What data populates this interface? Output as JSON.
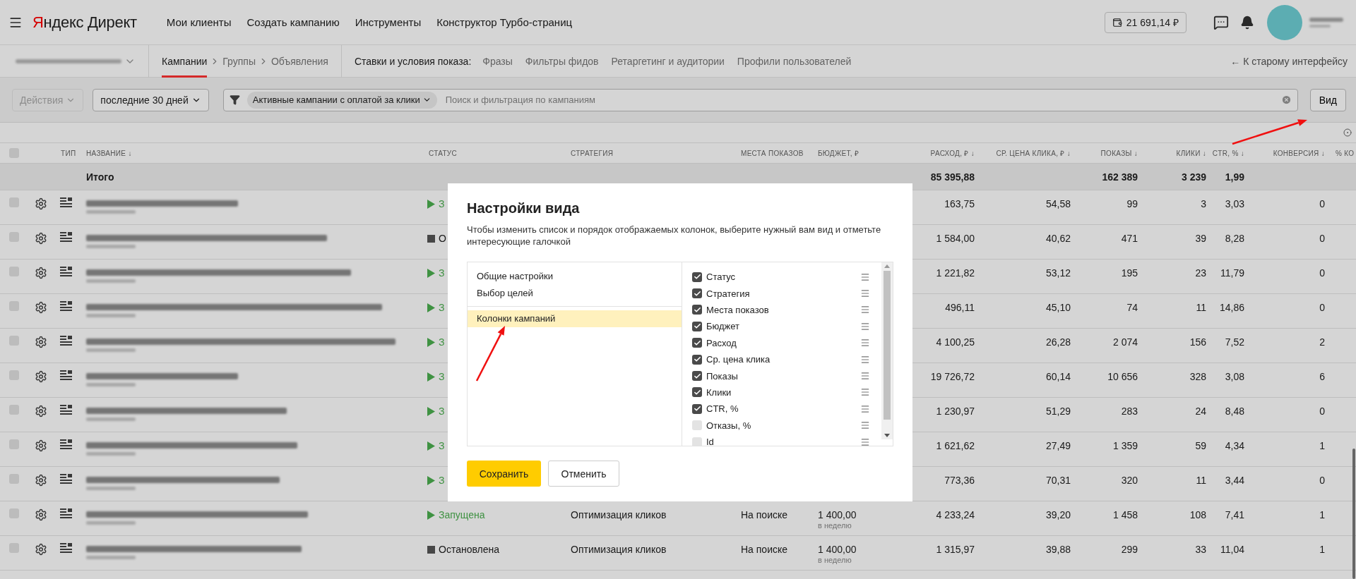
{
  "header": {
    "logo": {
      "brand": "Яндекс",
      "product": "Директ"
    },
    "nav": [
      "Мои клиенты",
      "Создать кампанию",
      "Инструменты",
      "Конструктор Турбо-страниц"
    ],
    "balance": "21 691,14 ₽"
  },
  "subnav": {
    "levels": [
      {
        "label": "Кампании",
        "selected": true
      },
      {
        "label": "Группы",
        "selected": false
      },
      {
        "label": "Объявления",
        "selected": false
      }
    ],
    "conditions_label": "Ставки и условия показа:",
    "conditions": [
      "Фразы",
      "Фильтры фидов",
      "Ретаргетинг и аудитории",
      "Профили пользователей"
    ],
    "old_interface": "← К старому интерфейсу"
  },
  "toolbar": {
    "actions": {
      "label": "Действия",
      "disabled": true
    },
    "period": "последние 30 дней",
    "filter_chip": "Активные кампании с оплатой за клики",
    "search": {
      "placeholder": "Поиск и фильтрация по кампаниям"
    },
    "view_button": "Вид"
  },
  "table": {
    "header_checkbox": {
      "checked": false
    },
    "columns": [
      "ТИП",
      "НАЗВАНИЕ ↓",
      "СТАТУС",
      "СТРАТЕГИЯ",
      "МЕСТА ПОКАЗОВ",
      "БЮДЖЕТ, ₽",
      "РАСХОД, ₽ ↓",
      "СР. ЦЕНА КЛИКА, ₽ ↓",
      "ПОКАЗЫ ↓",
      "КЛИКИ ↓",
      "CTR, % ↓",
      "КОНВЕРСИЯ ↓",
      "% КО"
    ],
    "total": {
      "label": "Итого",
      "spend": "85 395,88",
      "impressions": "162 389",
      "clicks": "3 239",
      "ctr": "1,99"
    },
    "rows": [
      {
        "checked": false,
        "status": {
          "kind": "running",
          "text": "З"
        },
        "spend": "163,75",
        "cpc": "54,58",
        "impressions": "99",
        "clicks": "3",
        "ctr": "3,03",
        "conversions": "0"
      },
      {
        "checked": false,
        "status": {
          "kind": "stopped",
          "text": "О"
        },
        "spend": "1 584,00",
        "cpc": "40,62",
        "impressions": "471",
        "clicks": "39",
        "ctr": "8,28",
        "conversions": "0"
      },
      {
        "checked": false,
        "status": {
          "kind": "running",
          "text": "З"
        },
        "spend": "1 221,82",
        "cpc": "53,12",
        "impressions": "195",
        "clicks": "23",
        "ctr": "11,79",
        "conversions": "0"
      },
      {
        "checked": false,
        "status": {
          "kind": "running",
          "text": "З"
        },
        "spend": "496,11",
        "cpc": "45,10",
        "impressions": "74",
        "clicks": "11",
        "ctr": "14,86",
        "conversions": "0"
      },
      {
        "checked": false,
        "status": {
          "kind": "running",
          "text": "З"
        },
        "spend": "4 100,25",
        "cpc": "26,28",
        "impressions": "2 074",
        "clicks": "156",
        "ctr": "7,52",
        "conversions": "2"
      },
      {
        "checked": false,
        "status": {
          "kind": "running",
          "text": "З"
        },
        "spend": "19 726,72",
        "cpc": "60,14",
        "impressions": "10 656",
        "clicks": "328",
        "ctr": "3,08",
        "conversions": "6"
      },
      {
        "checked": false,
        "status": {
          "kind": "running",
          "text": "З"
        },
        "spend": "1 230,97",
        "cpc": "51,29",
        "impressions": "283",
        "clicks": "24",
        "ctr": "8,48",
        "conversions": "0"
      },
      {
        "checked": false,
        "status": {
          "kind": "running",
          "text": "З"
        },
        "spend": "1 621,62",
        "cpc": "27,49",
        "impressions": "1 359",
        "clicks": "59",
        "ctr": "4,34",
        "conversions": "1"
      },
      {
        "checked": false,
        "status": {
          "kind": "running",
          "text": "З"
        },
        "spend": "773,36",
        "cpc": "70,31",
        "impressions": "320",
        "clicks": "11",
        "ctr": "3,44",
        "conversions": "0"
      },
      {
        "checked": false,
        "status": {
          "kind": "running",
          "text": "Запущена"
        },
        "strategy": "Оптимизация кликов",
        "places": "На поиске",
        "budget": {
          "amount": "1 400,00",
          "period": "в неделю"
        },
        "spend": "4 233,24",
        "cpc": "39,20",
        "impressions": "1 458",
        "clicks": "108",
        "ctr": "7,41",
        "conversions": "1"
      },
      {
        "checked": false,
        "status": {
          "kind": "stopped",
          "text": "Остановлена"
        },
        "strategy": "Оптимизация кликов",
        "places": "На поиске",
        "budget": {
          "amount": "1 400,00",
          "period": "в неделю"
        },
        "spend": "1 315,97",
        "cpc": "39,88",
        "impressions": "299",
        "clicks": "33",
        "ctr": "11,04",
        "conversions": "1"
      }
    ]
  },
  "dialog": {
    "title": "Настройки вида",
    "description": "Чтобы изменить список и порядок отображаемых колонок, выберите нужный вам вид и отметьте интересующие галочкой",
    "section_groups": [
      {
        "items": [
          {
            "label": "Общие настройки",
            "selected": false
          },
          {
            "label": "Выбор целей",
            "selected": false
          }
        ]
      },
      {
        "items": [
          {
            "label": "Колонки кампаний",
            "selected": true
          }
        ]
      }
    ],
    "columns": [
      {
        "label": "Статус",
        "checked": true
      },
      {
        "label": "Стратегия",
        "checked": true
      },
      {
        "label": "Места показов",
        "checked": true
      },
      {
        "label": "Бюджет",
        "checked": true
      },
      {
        "label": "Расход",
        "checked": true
      },
      {
        "label": "Ср. цена клика",
        "checked": true
      },
      {
        "label": "Показы",
        "checked": true
      },
      {
        "label": "Клики",
        "checked": true
      },
      {
        "label": "CTR, %",
        "checked": true
      },
      {
        "label": "Отказы, %",
        "checked": false
      },
      {
        "label": "Id",
        "checked": false
      }
    ],
    "buttons": {
      "save": "Сохранить",
      "cancel": "Отменить"
    }
  }
}
